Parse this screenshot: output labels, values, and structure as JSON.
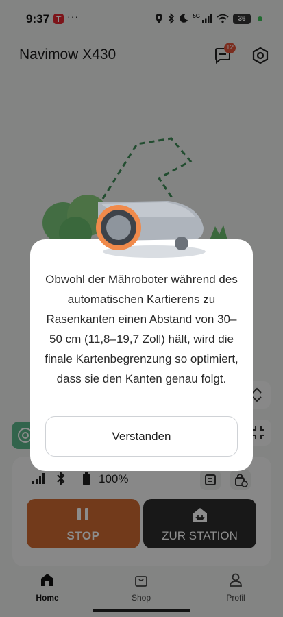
{
  "status_bar": {
    "time": "9:37",
    "more": "···",
    "network": "5G",
    "battery": "36"
  },
  "header": {
    "title": "Navimow X430",
    "message_badge": "12"
  },
  "mower_status": {
    "battery_percent": "100%"
  },
  "actions": {
    "stop_label": "STOP",
    "station_label": "ZUR STATION"
  },
  "nav": {
    "items": [
      {
        "label": "Home",
        "icon": "home-icon",
        "active": true
      },
      {
        "label": "Shop",
        "icon": "shopping-bag-icon",
        "active": false
      },
      {
        "label": "Profil",
        "icon": "person-icon",
        "active": false
      }
    ]
  },
  "dialog": {
    "message": "Obwohl der Mähroboter während des automatischen Kartierens zu Rasenkanten einen Abstand von 30–50 cm (11,8–19,7 Zoll) hält, wird die finale Kartenbegrenzung so optimiert, dass sie den Kanten genau folgt.",
    "confirm_label": "Verstanden"
  },
  "colors": {
    "stop": "#d06a32",
    "station": "#2d2d2d",
    "accent_green": "#5bb68a",
    "mower_ring": "#f08a4b"
  }
}
